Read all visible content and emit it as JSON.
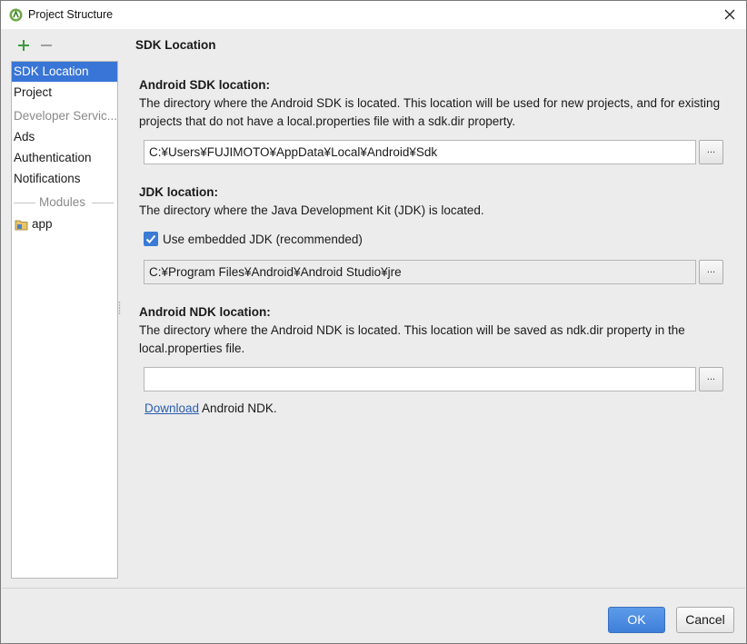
{
  "window": {
    "title": "Project Structure",
    "app_icon": "android-studio-icon",
    "close_icon": "close-icon"
  },
  "toolbar": {
    "add_icon": "plus-icon",
    "remove_icon": "minus-icon"
  },
  "sidebar": {
    "items": [
      {
        "label": "SDK Location",
        "selected": true
      },
      {
        "label": "Project",
        "selected": false
      }
    ],
    "developer_services_header": "Developer Servic...",
    "service_items": [
      {
        "label": "Ads"
      },
      {
        "label": "Authentication"
      },
      {
        "label": "Notifications"
      }
    ],
    "modules_header": "Modules",
    "modules": [
      {
        "label": "app",
        "icon": "module-folder-icon"
      }
    ]
  },
  "main": {
    "section_title": "SDK Location",
    "sdk": {
      "label": "Android SDK location:",
      "description": "The directory where the Android SDK is located. This location will be used for new projects, and for existing projects that do not have a local.properties file with a sdk.dir property.",
      "path": "C:¥Users¥FUJIMOTO¥AppData¥Local¥Android¥Sdk",
      "browse_label": "..."
    },
    "jdk": {
      "label": "JDK location:",
      "description": "The directory where the Java Development Kit (JDK) is located.",
      "checkbox_label": "Use embedded JDK (recommended)",
      "checked": true,
      "path": "C:¥Program Files¥Android¥Android Studio¥jre",
      "browse_label": "..."
    },
    "ndk": {
      "label": "Android NDK location:",
      "description": "The directory where the Android NDK is located. This location will be saved as ndk.dir property in the local.properties file.",
      "path": "",
      "browse_label": "...",
      "download_link": "Download",
      "download_suffix": " Android NDK."
    }
  },
  "buttons": {
    "ok": "OK",
    "cancel": "Cancel"
  },
  "colors": {
    "selection": "#3875d7",
    "primary_button": "#4a8ae0",
    "link": "#2a5db0",
    "add_green": "#3d9a3d"
  }
}
